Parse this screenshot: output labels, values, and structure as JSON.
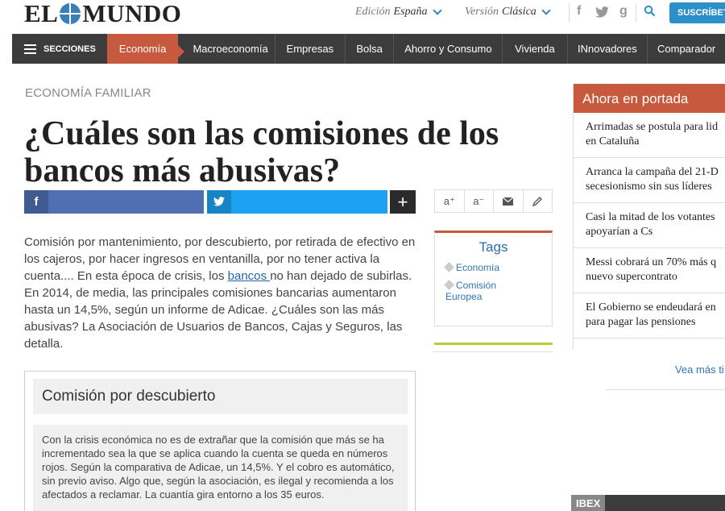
{
  "header": {
    "logo": {
      "left": "EL",
      "right": "MUNDO"
    },
    "edition_label": "Edición",
    "edition_value": "España",
    "version_label": "Versión",
    "version_value": "Clásica",
    "social": {
      "facebook": "f",
      "google": "g"
    },
    "subscribe_label": "SUSCRÍBETE"
  },
  "nav": {
    "sections_label": "SECCIONES",
    "active": "Economía",
    "items": [
      "Macroeconomía",
      "Empresas",
      "Bolsa",
      "Ahorro y Consumo",
      "Vivienda",
      "INnovadores",
      "Comparador"
    ]
  },
  "article": {
    "kicker": "ECONOMÍA FAMILIAR",
    "title_line1": "¿Cuáles son las comisiones de los",
    "title_line2": "bancos más abusivas?",
    "share": {
      "facebook": "f",
      "more": "+"
    },
    "lead_before": "Comisión por mantenimiento, por descubierto, por retirada de efectivo en los cajeros, por hacer ingresos en ventanilla, por no tener activa la cuenta.... En esta época de crisis, los ",
    "lead_link": "bancos ",
    "lead_after": "no han dejado de subirlas. En 2014, de media, las principales comisiones bancarias aumentaron hasta un 14,5%, según un informe de Adicae. ¿Cuáles son las más abusivas? La Asociación de Usuarios de Bancos, Cajas y Seguros, las detalla.",
    "box_title": "Comisión por descubierto",
    "box_text": "Con la crisis económica no es de extrañar que la comisión que más se ha incrementado sea la que se aplica cuando la cuenta se queda en números rojos. Según la comparativa de Adicae, un 14,5%. Y el cobro es automático, sin previo aviso. Algo que, según la asociación, es ilegal y recomienda a los afectados a reclamar. La cuantía gira entorno a los 35 euros."
  },
  "tools": {
    "font_up": "a⁺",
    "font_down": "a⁻"
  },
  "tags": {
    "title": "Tags",
    "items": [
      "Economía",
      "Comisión Europea"
    ]
  },
  "sidebar": {
    "heading": "Ahora en portada",
    "items": [
      "Arrimadas se postula para lid",
      "en Cataluña",
      "Arranca la campaña del 21-D",
      "secesionismo sin sus líderes",
      "Casi la mitad de los votantes",
      "apoyarían a Cs",
      "Messi cobrará un 70% más q",
      "nuevo supercontrato",
      "El Gobierno se endeudará en",
      "para pagar las pensiones"
    ],
    "more": "Vea más ti"
  },
  "market": {
    "label": "IBEX"
  }
}
